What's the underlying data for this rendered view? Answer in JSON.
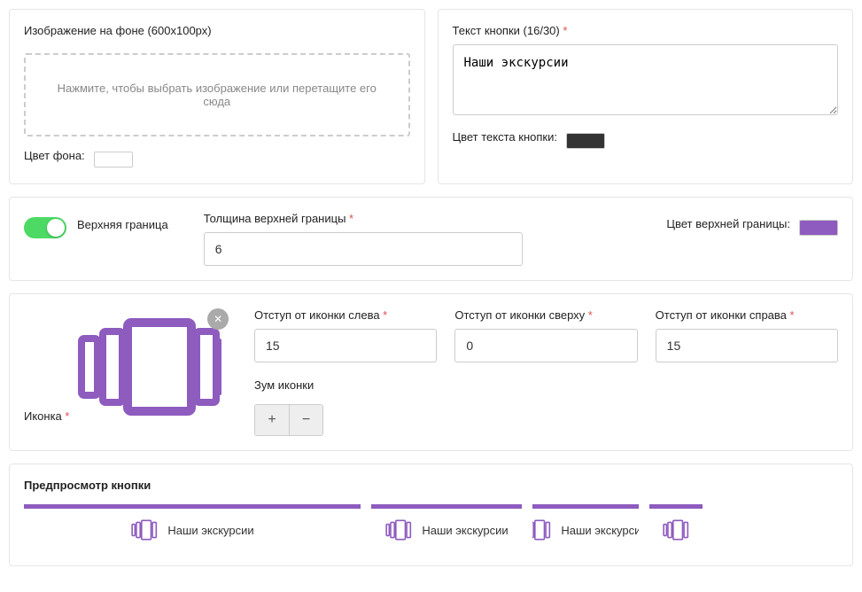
{
  "bgImage": {
    "label": "Изображение на фоне (600х100рх)",
    "dropzone": "Нажмите, чтобы выбрать изображение или перетащите его сюда",
    "bgColorLabel": "Цвет фона:",
    "bgColor": "#ffffff"
  },
  "buttonText": {
    "label": "Текст кнопки (16/30)",
    "value": "Наши экскурсии",
    "textColorLabel": "Цвет текста кнопки:",
    "textColor": "#333333"
  },
  "topBorder": {
    "toggleLabel": "Верхняя граница",
    "enabled": true,
    "thicknessLabel": "Толщина верхней границы",
    "thickness": "6",
    "colorLabel": "Цвет верхней границы:",
    "color": "#8e5bbf"
  },
  "icon": {
    "label": "Иконка",
    "marginLeftLabel": "Отступ от иконки слева",
    "marginLeft": "15",
    "marginTopLabel": "Отступ от иконки сверху",
    "marginTop": "0",
    "marginRightLabel": "Отступ от иконки справа",
    "marginRight": "15",
    "zoomLabel": "Зум иконки"
  },
  "preview": {
    "title": "Предпросмотр кнопки",
    "label": "Наши экскурсии"
  }
}
